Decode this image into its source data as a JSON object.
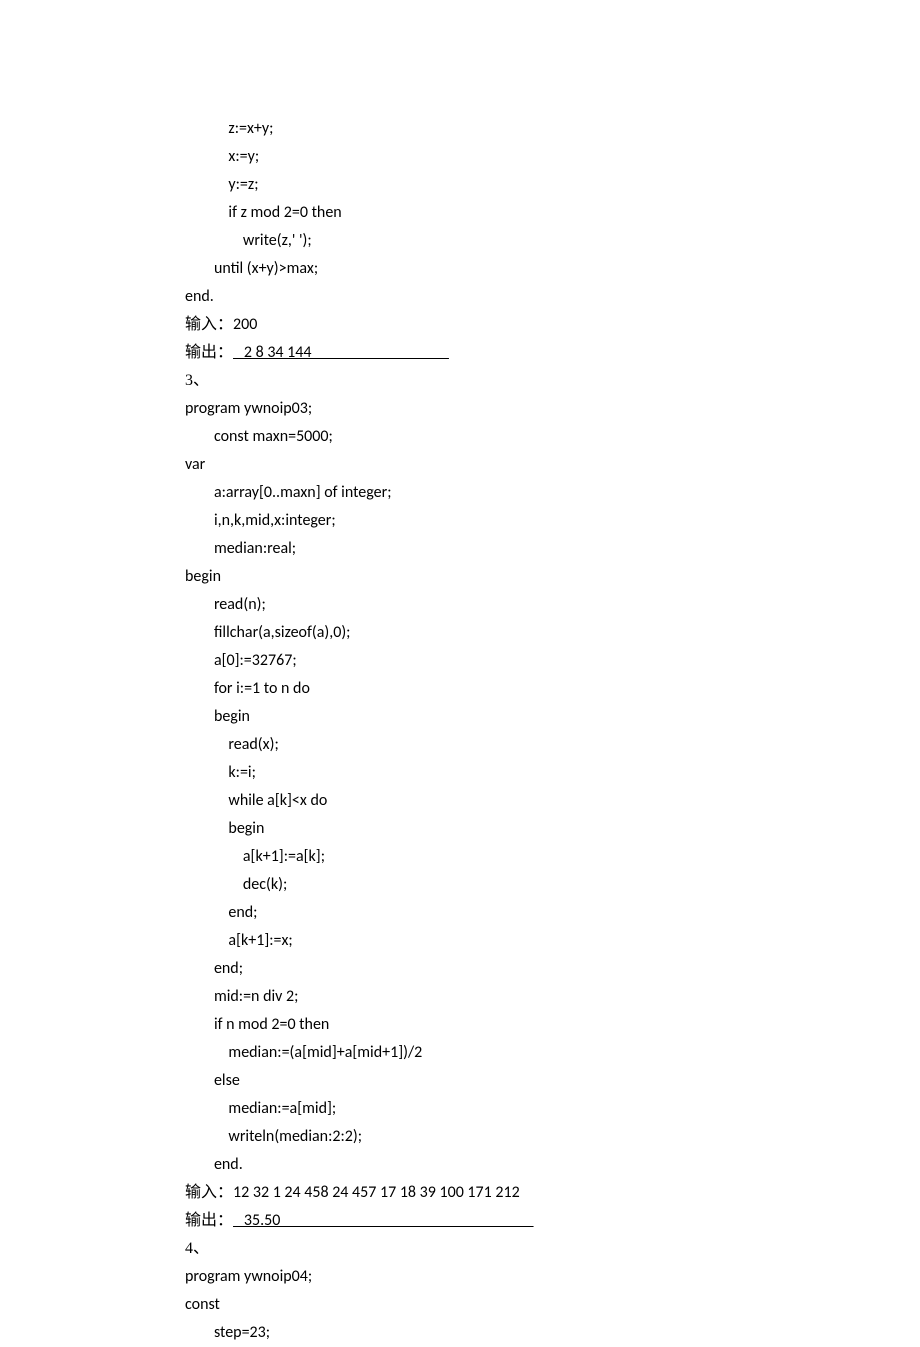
{
  "lines": [
    {
      "indent": 3,
      "text": "z:=x+y;"
    },
    {
      "indent": 3,
      "text": "x:=y;"
    },
    {
      "indent": 3,
      "text": "y:=z;"
    },
    {
      "indent": 3,
      "text": "if z mod 2=0 then"
    },
    {
      "indent": 4,
      "text": "write(z,' ');"
    },
    {
      "indent": 2,
      "text": "until (x+y)>max;"
    },
    {
      "indent": 0,
      "text": "end."
    },
    {
      "indent": 0,
      "cjk": "输入：",
      "text": "200"
    },
    {
      "indent": 0,
      "cjk": "输出：",
      "underline_prefix": "   ",
      "answer": "2 8 34 144",
      "tail_len": 38
    },
    {
      "indent": 0,
      "cjk": "3、"
    },
    {
      "indent": 0,
      "text": "program ywnoip03;"
    },
    {
      "indent": 2,
      "text": "const maxn=5000;"
    },
    {
      "indent": 0,
      "text": "var"
    },
    {
      "indent": 2,
      "text": "a:array[0..maxn] of integer;"
    },
    {
      "indent": 2,
      "text": "i,n,k,mid,x:integer;"
    },
    {
      "indent": 2,
      "text": "median:real;"
    },
    {
      "indent": 0,
      "text": "begin"
    },
    {
      "indent": 2,
      "text": "read(n);"
    },
    {
      "indent": 2,
      "text": "fillchar(a,sizeof(a),0);"
    },
    {
      "indent": 2,
      "text": "a[0]:=32767;"
    },
    {
      "indent": 2,
      "text": "for i:=1 to n do"
    },
    {
      "indent": 2,
      "text": "begin"
    },
    {
      "indent": 3,
      "text": "read(x);"
    },
    {
      "indent": 3,
      "text": "k:=i;"
    },
    {
      "indent": 3,
      "text": "while a[k]<x do"
    },
    {
      "indent": 3,
      "text": "begin"
    },
    {
      "indent": 4,
      "text": "a[k+1]:=a[k];"
    },
    {
      "indent": 4,
      "text": "dec(k);"
    },
    {
      "indent": 3,
      "text": "end;"
    },
    {
      "indent": 3,
      "text": "a[k+1]:=x;"
    },
    {
      "indent": 2,
      "text": "end;"
    },
    {
      "indent": 2,
      "text": "mid:=n div 2;"
    },
    {
      "indent": 2,
      "text": "if n mod 2=0 then"
    },
    {
      "indent": 3,
      "text": "median:=(a[mid]+a[mid+1])/2"
    },
    {
      "indent": 2,
      "text": "else"
    },
    {
      "indent": 3,
      "text": "median:=a[mid];"
    },
    {
      "indent": 3,
      "text": "writeln(median:2:2);"
    },
    {
      "indent": 2,
      "text": "end."
    },
    {
      "indent": 0,
      "cjk": "输入：",
      "text": "12 32 1 24 458 24 457 17 18 39 100 171 212"
    },
    {
      "indent": 0,
      "cjk": "输出：",
      "underline_prefix": "   ",
      "answer": "35.50",
      "tail_len": 70
    },
    {
      "indent": 0,
      "cjk": "4、"
    },
    {
      "indent": 0,
      "text": "program ywnoip04;"
    },
    {
      "indent": 0,
      "text": "const"
    },
    {
      "indent": 2,
      "text": "step=23;"
    }
  ],
  "indent_unit": "    "
}
